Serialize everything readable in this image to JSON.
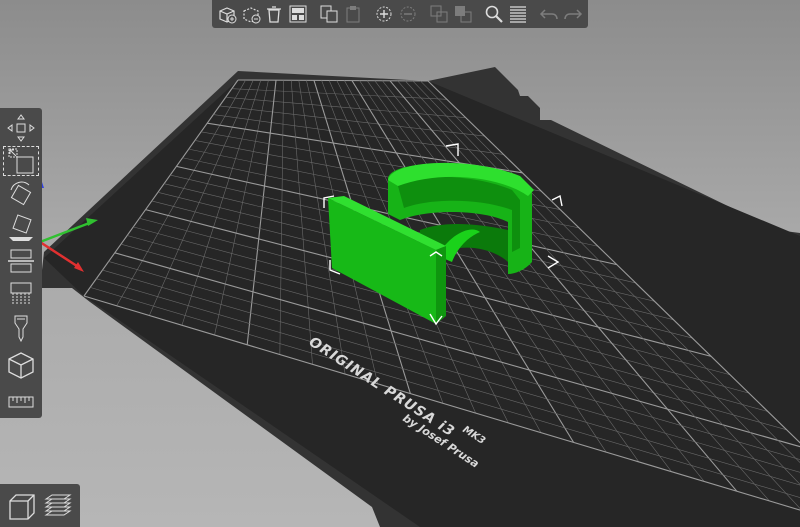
{
  "bed": {
    "brand_line": "ORIGINAL PRUSA i3",
    "model": "MK3",
    "byline": "by Josef Prusa"
  },
  "colors": {
    "background_top": "#8c8c8c",
    "toolbar_bg": "#4a4a4a",
    "bed_surface": "#2a2a2a",
    "bed_frame": "#3a3a3a",
    "grid_line": "#6f6f6f",
    "object_green": "#1ec81e",
    "axis_x": "#e03030",
    "axis_y": "#30c030",
    "axis_z": "#3040e0"
  },
  "top_toolbar": [
    {
      "name": "add-icon",
      "enabled": true
    },
    {
      "name": "delete-icon",
      "enabled": true
    },
    {
      "name": "delete-all-icon",
      "enabled": true
    },
    {
      "name": "arrange-icon",
      "enabled": true
    },
    {
      "name": "copy-icon",
      "enabled": true
    },
    {
      "name": "paste-icon",
      "enabled": false
    },
    {
      "name": "add-instance-icon",
      "enabled": true
    },
    {
      "name": "remove-instance-icon",
      "enabled": false
    },
    {
      "name": "split-objects-icon",
      "enabled": false
    },
    {
      "name": "split-parts-icon",
      "enabled": false
    },
    {
      "name": "search-icon",
      "enabled": true
    },
    {
      "name": "layers-editing-icon",
      "enabled": true
    },
    {
      "name": "undo-icon",
      "enabled": false
    },
    {
      "name": "redo-icon",
      "enabled": false
    }
  ],
  "left_toolbar": [
    {
      "name": "move-icon"
    },
    {
      "name": "scale-icon",
      "active": true
    },
    {
      "name": "rotate-icon"
    },
    {
      "name": "place-on-face-icon"
    },
    {
      "name": "cut-icon"
    },
    {
      "name": "paint-supports-icon"
    },
    {
      "name": "seam-painting-icon"
    },
    {
      "name": "measure-icon"
    }
  ],
  "view_toggle": [
    {
      "name": "3d-view-icon"
    },
    {
      "name": "preview-icon"
    }
  ]
}
